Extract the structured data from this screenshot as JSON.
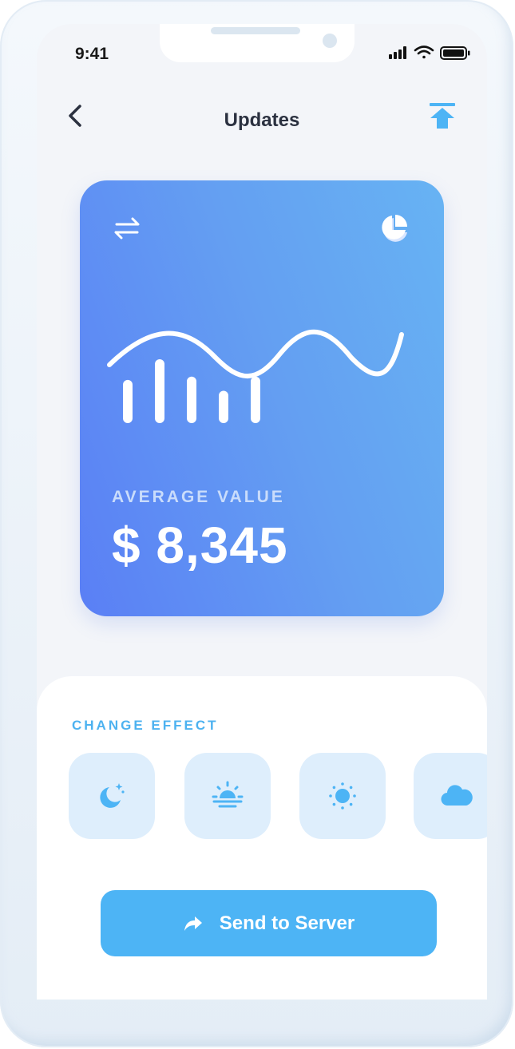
{
  "status_bar": {
    "time": "9:41"
  },
  "header": {
    "title": "Updates"
  },
  "card": {
    "label": "AVERAGE VALUE",
    "value": "$ 8,345",
    "bars": [
      0.62,
      1.0,
      0.68,
      0.42,
      0.68
    ]
  },
  "effects": {
    "label": "CHANGE EFFECT",
    "items": [
      {
        "icon": "moon-stars-icon"
      },
      {
        "icon": "sunrise-icon"
      },
      {
        "icon": "sun-icon"
      },
      {
        "icon": "cloud-icon"
      }
    ]
  },
  "action": {
    "send_label": "Send to Server",
    "icon": "share-arrow-icon"
  },
  "colors": {
    "accent": "#4db4f5",
    "card_start": "#5a7ff5",
    "card_end": "#67b3f3",
    "effect_bg": "#deeefc"
  }
}
